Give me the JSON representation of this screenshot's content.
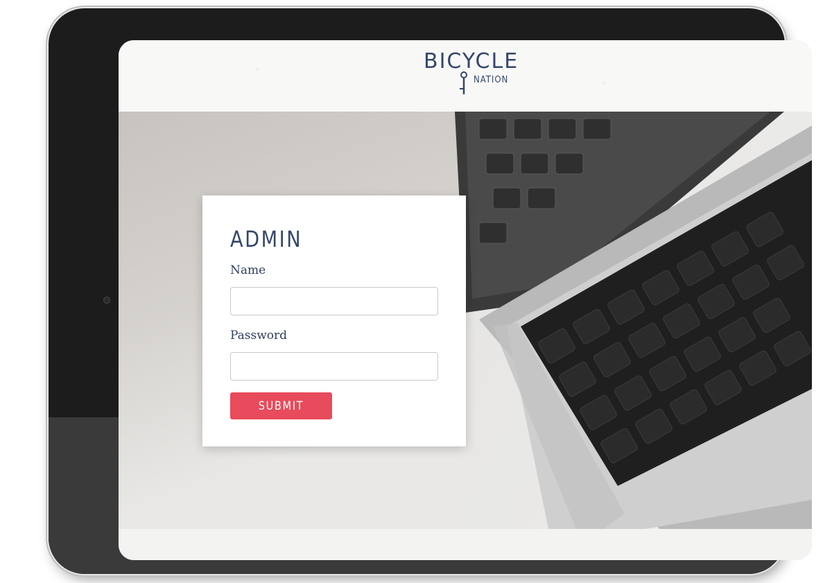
{
  "brand": {
    "logo_word": "BICYCLE",
    "logo_sub": "NATION",
    "primary_color": "#34466b",
    "accent_color": "#e84b5b"
  },
  "login": {
    "title": "ADMIN",
    "name_label": "Name",
    "name_value": "",
    "password_label": "Password",
    "password_value": "",
    "submit_label": "SUBMIT"
  },
  "icons": {
    "logo_figure": "cyclist-icon"
  }
}
